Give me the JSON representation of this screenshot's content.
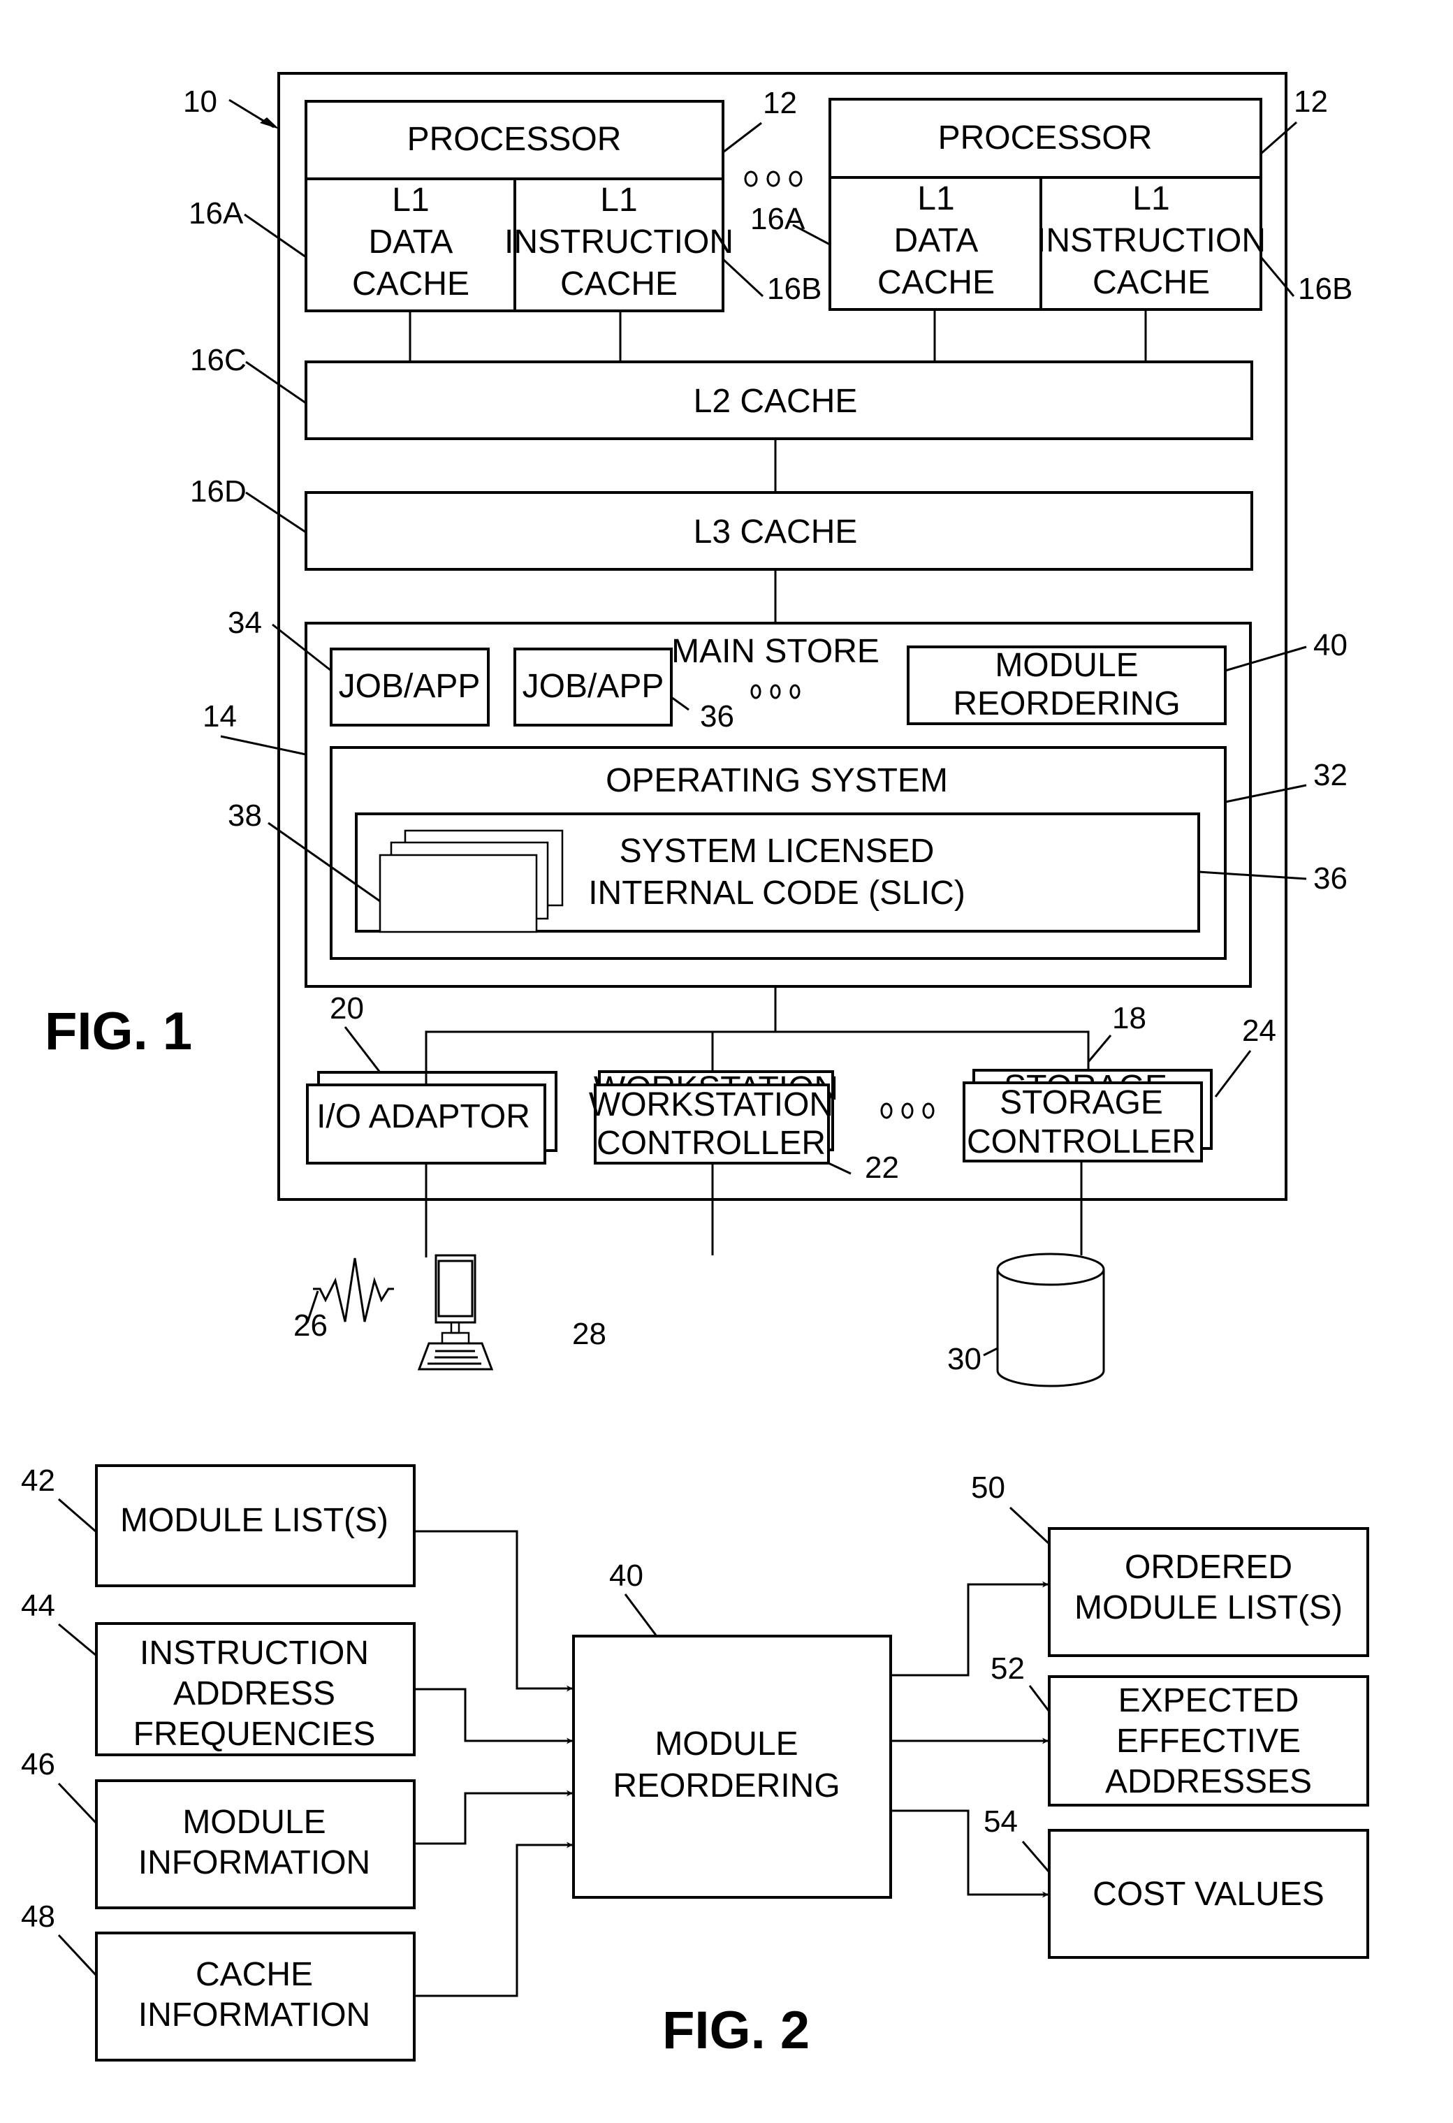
{
  "fig1": {
    "caption": "FIG. 1",
    "system_ref": "10",
    "processors": [
      {
        "ref": "12",
        "title": "PROCESSOR",
        "l1_data": {
          "ref": "16A",
          "lines": [
            "L1",
            "DATA",
            "CACHE"
          ]
        },
        "l1_instr": {
          "ref": "16B",
          "lines": [
            "L1",
            "INSTRUCTION",
            "CACHE"
          ]
        }
      },
      {
        "ref": "12",
        "title": "PROCESSOR",
        "l1_data": {
          "ref": "16A",
          "lines": [
            "L1",
            "DATA",
            "CACHE"
          ]
        },
        "l1_instr": {
          "ref": "16B",
          "lines": [
            "L1",
            "INSTRUCTION",
            "CACHE"
          ]
        }
      }
    ],
    "l2": {
      "ref": "16C",
      "label": "L2 CACHE"
    },
    "l3": {
      "ref": "16D",
      "label": "L3 CACHE"
    },
    "main_store": {
      "ref": "14",
      "label": "MAIN STORE",
      "jobs": [
        {
          "ref": "34",
          "label": "JOB/APP"
        },
        {
          "ref": "36",
          "label": "JOB/APP"
        }
      ],
      "module_reordering": {
        "ref": "40",
        "lines": [
          "MODULE",
          "REORDERING"
        ]
      },
      "os": {
        "ref": "32",
        "label": "OPERATING SYSTEM",
        "slic": {
          "ref": "36",
          "lines": [
            "SYSTEM LICENSED",
            "INTERNAL CODE (SLIC)"
          ]
        },
        "modules_ref": "38"
      }
    },
    "bus_ref": "18",
    "adaptors": [
      {
        "ref": "20",
        "name": "io-adaptor",
        "lines": [
          "I/O ADAPTOR"
        ],
        "back_lines": []
      },
      {
        "ref": "22",
        "name": "workstation-controller",
        "lines": [
          "WORKSTATION",
          "CONTROLLER"
        ],
        "back_lines": [
          "WORKSTATION"
        ]
      },
      {
        "ref": "24",
        "name": "storage-controller",
        "lines": [
          "STORAGE",
          "CONTROLLER"
        ],
        "back_lines": [
          "STORAGE"
        ]
      }
    ],
    "peripherals": {
      "network": {
        "ref": "26",
        "icon": "network-zigzag-icon"
      },
      "workstation": {
        "ref": "28",
        "icon": "computer-terminal-icon"
      },
      "storage": {
        "ref": "30",
        "icon": "disk-cylinder-icon"
      }
    }
  },
  "fig2": {
    "caption": "FIG. 2",
    "inputs": [
      {
        "ref": "42",
        "lines": [
          "MODULE LIST(S)"
        ]
      },
      {
        "ref": "44",
        "lines": [
          "INSTRUCTION",
          "ADDRESS",
          "FREQUENCIES"
        ]
      },
      {
        "ref": "46",
        "lines": [
          "MODULE",
          "INFORMATION"
        ]
      },
      {
        "ref": "48",
        "lines": [
          "CACHE",
          "INFORMATION"
        ]
      }
    ],
    "center": {
      "ref": "40",
      "lines": [
        "MODULE",
        "REORDERING"
      ]
    },
    "outputs": [
      {
        "ref": "50",
        "lines": [
          "ORDERED",
          "MODULE LIST(S)"
        ]
      },
      {
        "ref": "52",
        "lines": [
          "EXPECTED",
          "EFFECTIVE",
          "ADDRESSES"
        ]
      },
      {
        "ref": "54",
        "lines": [
          "COST VALUES"
        ]
      }
    ]
  }
}
